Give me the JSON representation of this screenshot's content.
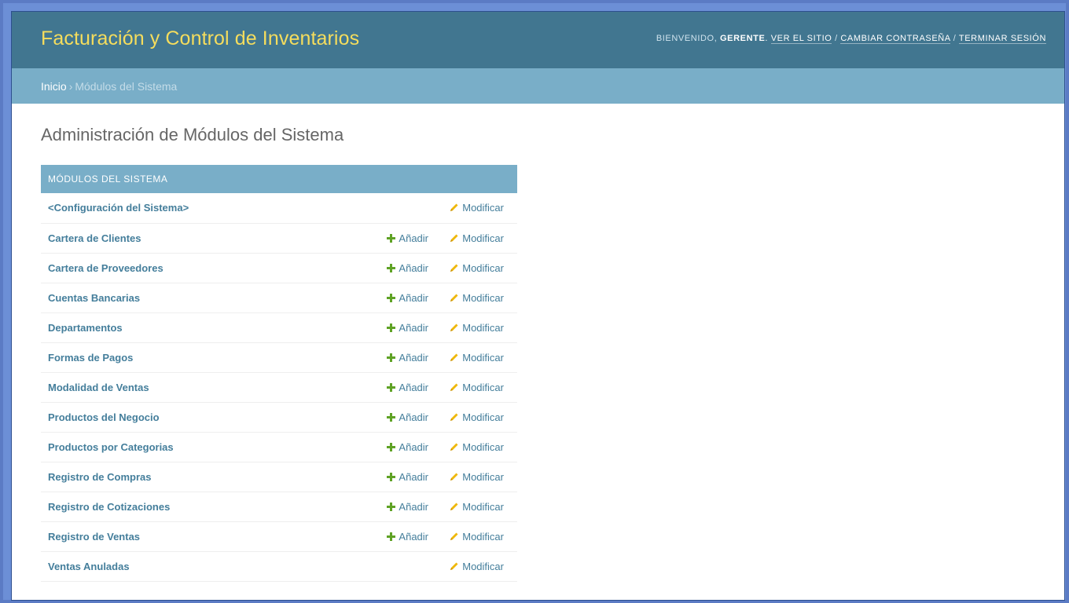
{
  "header": {
    "brand": "Facturación y Control de Inventarios",
    "greeting": "Bienvenido,",
    "username": "GERENTE",
    "view_site": "Ver el sitio",
    "change_password": "Cambiar contraseña",
    "logout": "Terminar sesión",
    "separator": "/"
  },
  "breadcrumbs": {
    "home": "Inicio",
    "separator": "›",
    "current": "Módulos del Sistema"
  },
  "page_title": "Administración de Módulos del Sistema",
  "module": {
    "caption": "Módulos del Sistema",
    "add_label": "Añadir",
    "change_label": "Modificar",
    "rows": [
      {
        "name": "<Configuración del Sistema>",
        "add": false
      },
      {
        "name": "Cartera de Clientes",
        "add": true
      },
      {
        "name": "Cartera de Proveedores",
        "add": true
      },
      {
        "name": "Cuentas Bancarias",
        "add": true
      },
      {
        "name": "Departamentos",
        "add": true
      },
      {
        "name": "Formas de Pagos",
        "add": true
      },
      {
        "name": "Modalidad de Ventas",
        "add": true
      },
      {
        "name": "Productos del Negocio",
        "add": true
      },
      {
        "name": "Productos por Categorias",
        "add": true
      },
      {
        "name": "Registro de Compras",
        "add": true
      },
      {
        "name": "Registro de Cotizaciones",
        "add": true
      },
      {
        "name": "Registro de Ventas",
        "add": true
      },
      {
        "name": "Ventas Anuladas",
        "add": false
      }
    ]
  },
  "colors": {
    "header_bg": "#417690",
    "brand": "#f5dd5d",
    "breadcrumb_bg": "#79aec8",
    "link": "#447e9b",
    "add_icon": "#5fa225",
    "change_icon": "#efb80b"
  },
  "icons": {
    "add": "plus-icon",
    "change": "pencil-icon"
  }
}
